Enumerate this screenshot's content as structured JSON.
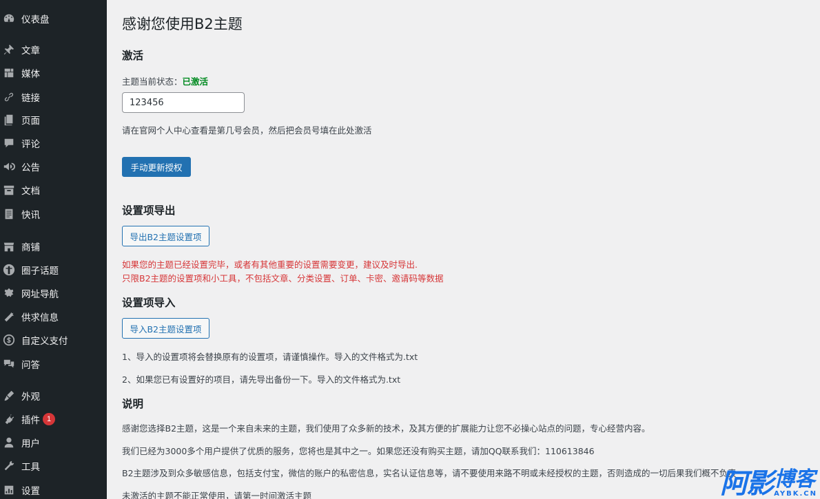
{
  "sidebar": {
    "items": [
      {
        "label": "仪表盘",
        "icon": "dashboard-icon"
      },
      {
        "label": "文章",
        "icon": "pin-icon"
      },
      {
        "label": "媒体",
        "icon": "media-icon"
      },
      {
        "label": "链接",
        "icon": "link-icon"
      },
      {
        "label": "页面",
        "icon": "page-icon"
      },
      {
        "label": "评论",
        "icon": "comment-icon"
      },
      {
        "label": "公告",
        "icon": "megaphone-icon"
      },
      {
        "label": "文档",
        "icon": "archive-icon"
      },
      {
        "label": "快讯",
        "icon": "document-icon"
      },
      {
        "label": "商铺",
        "icon": "store-icon"
      },
      {
        "label": "圈子话题",
        "icon": "accessibility-icon"
      },
      {
        "label": "网址导航",
        "icon": "tag-icon"
      },
      {
        "label": "供求信息",
        "icon": "carrot-icon"
      },
      {
        "label": "自定义支付",
        "icon": "dollar-icon"
      },
      {
        "label": "问答",
        "icon": "chat-icon"
      },
      {
        "label": "外观",
        "icon": "brush-icon"
      },
      {
        "label": "插件",
        "icon": "plugin-icon",
        "badge": "1"
      },
      {
        "label": "用户",
        "icon": "user-icon"
      },
      {
        "label": "工具",
        "icon": "wrench-icon"
      },
      {
        "label": "设置",
        "icon": "settings-icon"
      }
    ]
  },
  "main": {
    "title": "感谢您使用B2主题",
    "activation": {
      "heading": "激活",
      "status_label": "主题当前状态：",
      "status_value": "已激活",
      "member_value": "123456",
      "hint": "请在官网个人中心查看是第几号会员，然后把会员号填在此处激活",
      "update_button": "手动更新授权"
    },
    "export": {
      "heading": "设置项导出",
      "button": "导出B2主题设置项",
      "warning_1": "如果您的主题已经设置完毕，或者有其他重要的设置需要变更，建议及时导出.",
      "warning_2": "只限B2主题的设置项和小工具，不包括文章、分类设置、订单、卡密、邀请码等数据"
    },
    "import": {
      "heading": "设置项导入",
      "button": "导入B2主题设置项",
      "note_1": "1、导入的设置项将会替换原有的设置项，请谨慎操作。导入的文件格式为.txt",
      "note_2": "2、如果您已有设置好的项目，请先导出备份一下。导入的文件格式为.txt"
    },
    "info": {
      "heading": "说明",
      "p1": "感谢您选择B2主题，这是一个来自未来的主题，我们使用了众多新的技术，及其方便的扩展能力让您不必操心站点的问题，专心经营内容。",
      "p2": "我们已经为3000多个用户提供了优质的服务，您将也是其中之一。如果您还没有购买主题，请加QQ联系我们：110613846",
      "p3": "B2主题涉及到众多敏感信息，包括支付宝，微信的账户的私密信息，实名认证信息等，请不要使用来路不明或未经授权的主题，否则造成的一切后果我们概不负责",
      "p4": "未激活的主题不能正常使用，请第一时间激活主题"
    }
  },
  "watermark": {
    "big": "阿影",
    "cn": "博客",
    "en": "AYBK.CN"
  },
  "colors": {
    "sidebar_bg": "#1d2327",
    "accent": "#2271b1",
    "success": "#008a20",
    "danger": "#d63638",
    "watermark": "#1a73e8"
  }
}
